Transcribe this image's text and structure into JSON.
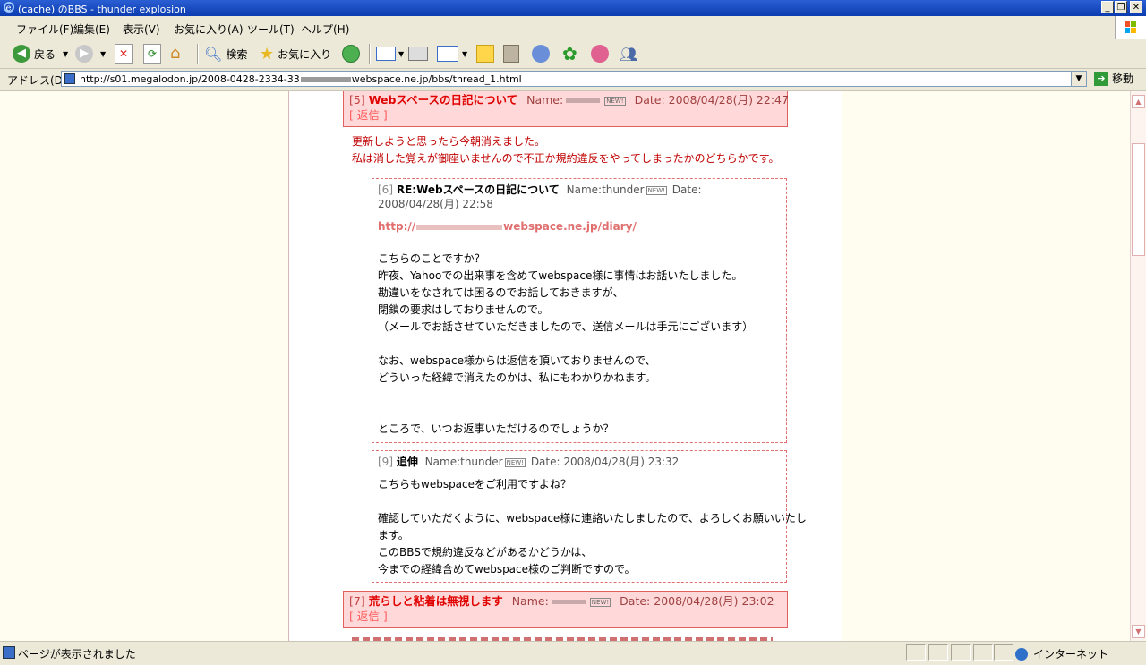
{
  "window": {
    "title": "(cache) のBBS - thunder explosion",
    "minimize": "_",
    "maximize": "❐",
    "close": "✕"
  },
  "menu": [
    "ファイル(F)",
    "編集(E)",
    "表示(V)",
    "お気に入り(A)",
    "ツール(T)",
    "ヘルプ(H)"
  ],
  "toolbar": {
    "back_label": "戻る",
    "search_label": "検索",
    "favorites_label": "お気に入り"
  },
  "address": {
    "label": "アドレス(D)",
    "url_prefix": "http://s01.megalodon.jp/2008-0428-2334-33",
    "url_suffix": "webspace.ne.jp/bbs/thread_1.html",
    "go_label": "移動"
  },
  "posts": [
    {
      "num": "[5]",
      "subject": "Webスペースの日記について",
      "name_label": "Name:",
      "date_label": "Date:",
      "date": "2008/04/28(月) 22:47",
      "reply_label": "[ 返信 ]",
      "body": [
        "更新しようと思ったら今朝消えました。",
        "私は消した覚えが御座いませんので不正か規約違反をやってしまったかのどちらかです。"
      ]
    },
    {
      "num": "[7]",
      "subject": "荒らしと粘着は無視します",
      "name_label": "Name:",
      "date_label": "Date:",
      "date": "2008/04/28(月) 23:02",
      "reply_label": "[ 返信 ]"
    }
  ],
  "replies": [
    {
      "num": "[6]",
      "subject": "RE:Webスペースの日記について",
      "name_label": "Name:",
      "name": "thunder",
      "date_label": "Date:",
      "date": "2008/04/28(月) 22:58",
      "link_prefix": "http://",
      "link_suffix": "webspace.ne.jp/diary/",
      "body": [
        "こちらのことですか？",
        "昨夜、Yahooでの出来事を含めてwebspace様に事情はお話いたしました。",
        "勘違いをなされては困るのでお話しておきますが、",
        "閉鎖の要求はしておりませんので。",
        "（メールでお話させていただきましたので、送信メールは手元にございます）",
        "",
        "なお、webspace様からは返信を頂いておりませんので、",
        "どういった経緯で消えたのかは、私にもわかりかねます。",
        "",
        "",
        "ところで、いつお返事いただけるのでしょうか？"
      ]
    },
    {
      "num": "[9]",
      "subject": "追伸",
      "name_label": "Name:",
      "name": "thunder",
      "date_label": "Date:",
      "date": "2008/04/28(月) 23:32",
      "body": [
        "こちらもwebspaceをご利用ですよね？",
        "",
        "確認していただくように、webspace様に連絡いたしましたので、よろしくお願いいたし",
        "ます。",
        "このBBSで規約違反などがあるかどうかは、",
        "今までの経緯含めてwebspace様のご判断ですので。"
      ]
    }
  ],
  "new_badge": "NEW!",
  "status": {
    "text": "ページが表示されました",
    "zone": "インターネット"
  }
}
